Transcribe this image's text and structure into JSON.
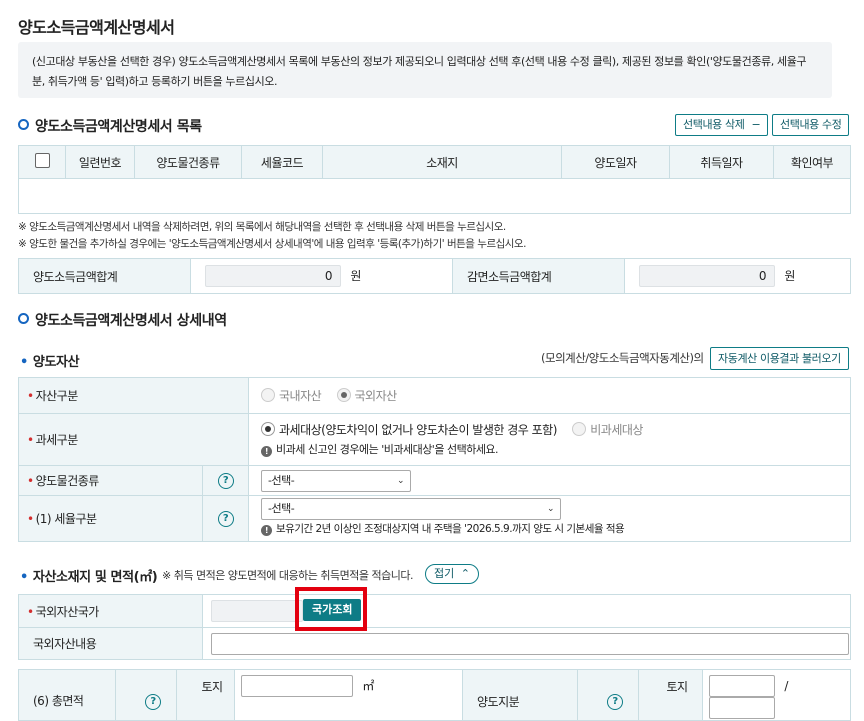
{
  "page_title": "양도소득금액계산명세서",
  "notice": "(신고대상 부동산을 선택한 경우) 양도소득금액계산명세서 목록에 부동산의 정보가 제공되오니 입력대상 선택 후(선택 내용 수정 클릭), 제공된 정보를 확인('양도물건종류, 세율구분, 취득가액 등' 입력)하고 등록하기 버튼을 누르십시오.",
  "list_section": {
    "title": "양도소득금액계산명세서 목록",
    "delete_button": "선택내용 삭제",
    "delete_icon": "minus-icon",
    "edit_button": "선택내용 수정",
    "columns": [
      "일련번호",
      "양도물건종류",
      "세율코드",
      "소재지",
      "양도일자",
      "취득일자",
      "확인여부"
    ],
    "notes": [
      "※ 양도소득금액계산명세서 내역을 삭제하려면, 위의 목록에서 해당내역을 선택한 후 선택내용 삭제 버튼을 누르십시오.",
      "※ 양도한 물건을 추가하실 경우에는 '양도소득금액계산명세서 상세내역'에 내용 입력후 '등록(추가)하기' 버튼을 누르십시오."
    ]
  },
  "summary": {
    "total_label": "양도소득금액합계",
    "total_value": "0",
    "total_unit": "원",
    "exempt_label": "감면소득금액합계",
    "exempt_value": "0",
    "exempt_unit": "원"
  },
  "detail_section": {
    "title": "양도소득금액계산명세서 상세내역",
    "asset_subtitle": "양도자산",
    "auto_calc_note": "(모의계산/양도소득금액자동계산)의",
    "auto_calc_button": "자동계산 이용결과 불러오기",
    "asset_type": {
      "label": "자산구분",
      "options": [
        "국내자산",
        "국외자산"
      ],
      "selected": "국외자산"
    },
    "tax_type": {
      "label": "과세구분",
      "options": [
        "과세대상(양도차익이 없거나 양도차손이 발생한 경우 포함)",
        "비과세대상"
      ],
      "selected": "과세대상(양도차익이 없거나 양도차손이 발생한 경우 포함)",
      "info": "비과세 신고인 경우에는 '비과세대상'을 선택하세요."
    },
    "property_kind": {
      "label": "양도물건종류",
      "value": "-선택-"
    },
    "tax_rate": {
      "label": "(1) 세율구분",
      "value": "-선택-",
      "info": "보유기간 2년 이상인 조정대상지역 내 주택을 '2026.5.9.까지 양도 시 기본세율 적용"
    },
    "help_glyph": "?",
    "info_glyph": "!"
  },
  "location_section": {
    "title": "자산소재지 및 면적(㎡)",
    "note": "※ 취득 면적은 양도면적에 대응하는 취득면적을 적습니다.",
    "fold_button": "접기",
    "fold_icon": "chevron-up-icon",
    "country_label": "국외자산국가",
    "country_value": "",
    "country_button": "국가조회",
    "content_label": "국외자산내용",
    "content_value": "",
    "area_label": "(6) 총면적",
    "land_label": "토지",
    "area_unit": "㎡",
    "share_label": "양도지분",
    "share_land_label": "토지",
    "share_separator": "/"
  },
  "colors": {
    "accent": "#0e7c86",
    "highlight": "#e3000f",
    "required": "#d32f2f"
  }
}
